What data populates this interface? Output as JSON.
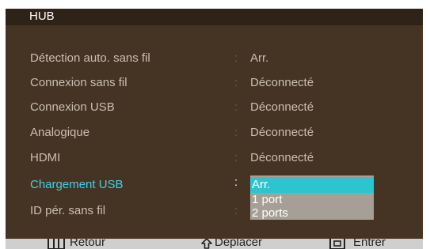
{
  "menu": {
    "title": "HUB",
    "rows": [
      {
        "label": "Détection auto. sans fil",
        "value": "Arr."
      },
      {
        "label": "Connexion sans fil",
        "value": "Déconnecté"
      },
      {
        "label": "Connexion USB",
        "value": "Déconnecté"
      },
      {
        "label": "Analogique",
        "value": "Déconnecté"
      },
      {
        "label": "HDMI",
        "value": "Déconnecté"
      },
      {
        "label": "Chargement USB",
        "value": ""
      },
      {
        "label": "ID pér. sans fil",
        "value": ""
      }
    ],
    "colon": ":",
    "active_row": "Chargement USB"
  },
  "dropdown": {
    "options": [
      "Arr.",
      "1 port",
      "2 ports"
    ],
    "selected": "Arr."
  },
  "footer": {
    "back": {
      "icon": "menu-icon",
      "label": "Retour"
    },
    "move": {
      "icon": "joystick-up-icon",
      "label": "Déplacer"
    },
    "enter": {
      "icon": "enter-icon",
      "label": "Entrer"
    }
  },
  "colors": {
    "panel": "#453424",
    "title_bar": "#2f2217",
    "active_label": "#3ad4e6",
    "selected_option": "#2ec4cf",
    "dropdown_bg": "#a59f95",
    "footer_bg": "#cfcfcf"
  }
}
